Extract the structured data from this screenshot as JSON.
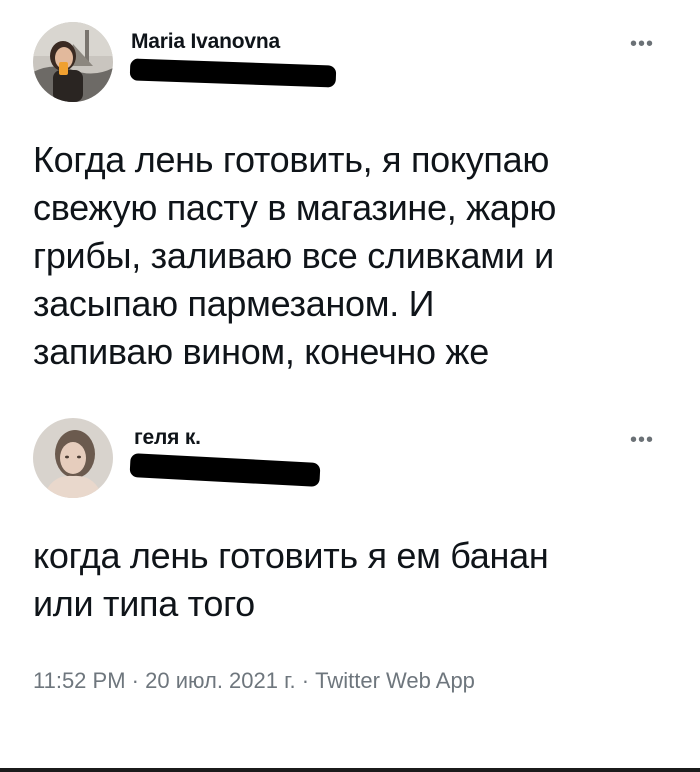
{
  "tweets": [
    {
      "author_name": "Maria Ivanovna",
      "more_label": "•••",
      "text_lines": [
        "Когда лень готовить, я покупаю",
        "свежую пасту в магазине, жарю",
        "грибы, заливаю все сливками и",
        "засыпаю пармезаном. И",
        "запиваю вином, конечно же"
      ]
    },
    {
      "author_name": "геля к.",
      "more_label": "•••",
      "text_lines": [
        "когда лень готовить я ем банан",
        "или типа того"
      ]
    }
  ],
  "meta": {
    "time": "11:52 PM",
    "separator": " · ",
    "date": "20 июл. 2021 г.",
    "source": "Twitter Web App"
  }
}
